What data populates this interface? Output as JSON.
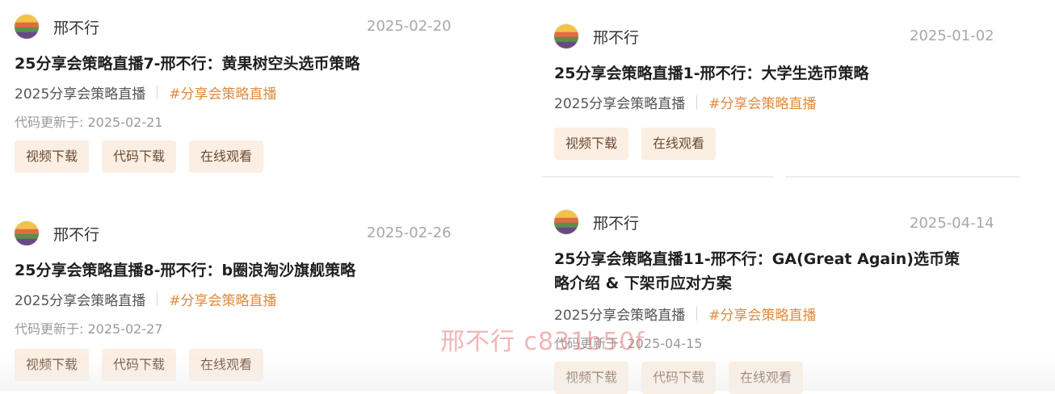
{
  "cards": [
    {
      "author": "邢不行",
      "date": "2025-02-20",
      "title": "25分享会策略直播7-邢不行：黄果树空头选币策略",
      "collection": "2025分享会策略直播",
      "tag": "#分享会策略直播",
      "update": "代码更新于: 2025-02-21",
      "buttons": [
        "视频下载",
        "代码下载",
        "在线观看"
      ]
    },
    {
      "author": "邢不行",
      "date": "2025-01-02",
      "title": "25分享会策略直播1-邢不行：大学生选币策略",
      "collection": "2025分享会策略直播",
      "tag": "#分享会策略直播",
      "buttons": [
        "视频下载",
        "在线观看"
      ]
    },
    {
      "author": "邢不行",
      "date": "2025-02-26",
      "title": "25分享会策略直播8-邢不行：b圈浪淘沙旗舰策略",
      "collection": "2025分享会策略直播",
      "tag": "#分享会策略直播",
      "update": "代码更新于: 2025-02-27",
      "buttons": [
        "视频下载",
        "代码下载",
        "在线观看"
      ]
    },
    {
      "author": "邢不行",
      "date": "2025-04-14",
      "title_line1": "25分享会策略直播11-邢不行：GA(Great Again)选币策",
      "title_line2": "略介绍 & 下架币应对方案",
      "collection": "2025分享会策略直播",
      "tag": "#分享会策略直播",
      "update": "代码更新于: 2025-04-15",
      "buttons": [
        "视频下载",
        "代码下载",
        "在线观看"
      ]
    }
  ],
  "watermark": "邢不行 c831b50f",
  "colors": {
    "tag": "#e08b3c",
    "button_bg": "#fbeee2",
    "date": "#a8a8a8"
  }
}
